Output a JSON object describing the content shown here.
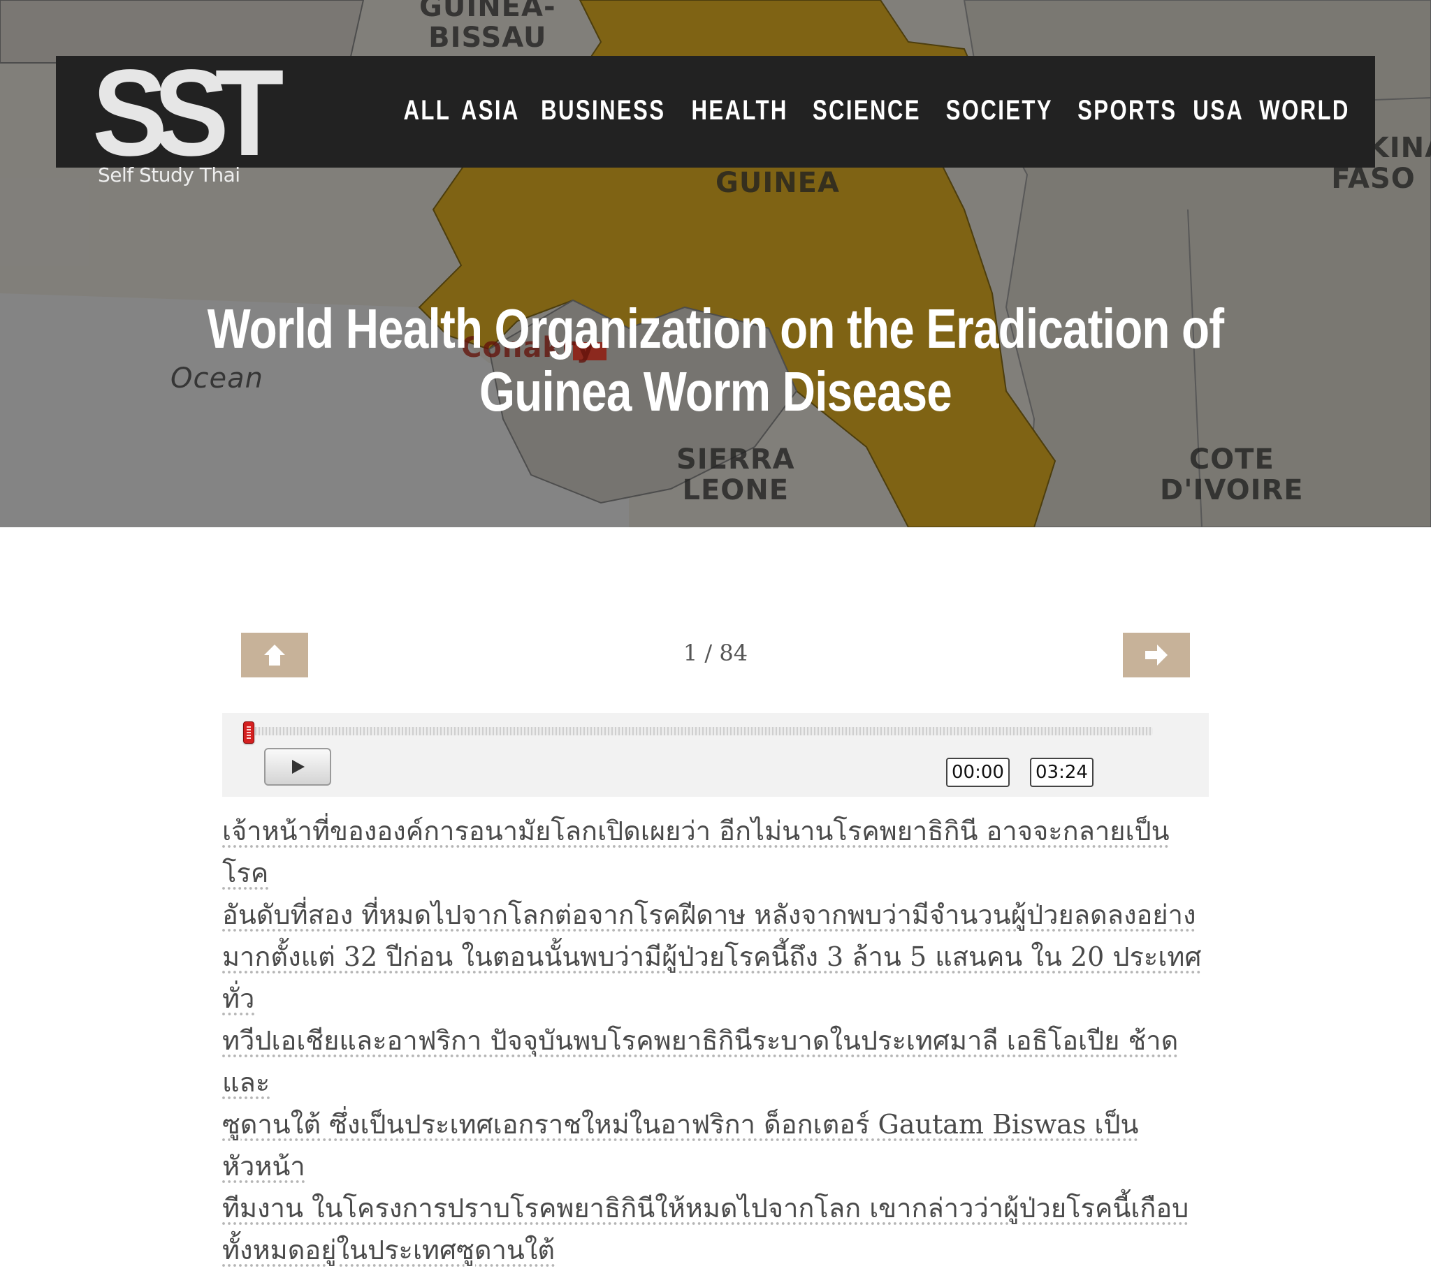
{
  "site": {
    "logo_text": "SST",
    "logo_subtitle": "Self Study Thai"
  },
  "nav": {
    "items": [
      "ALL",
      "ASIA",
      "BUSINESS",
      "HEALTH",
      "SCIENCE",
      "SOCIETY",
      "SPORTS",
      "USA",
      "WORLD"
    ]
  },
  "hero": {
    "map_labels": {
      "guinea_bissau": "GUINEA-\nBISSAU",
      "guinea": "GUINEA",
      "burkina_faso": "BURKINA\nFASO",
      "ocean": "Ocean",
      "conakry": "Conakry",
      "sierra_leone": "SIERRA\nLEONE",
      "cote_divoire": "COTE\nD'IVOIRE"
    },
    "colors": {
      "map_yellow": "#b08a1c",
      "map_land": "#a9a6a0"
    }
  },
  "article": {
    "title": "World Health Organization on the Eradication of Guinea Worm Disease"
  },
  "lesson": {
    "counter": "1 / 84",
    "up_icon": "arrow-up-icon",
    "next_icon": "arrow-right-icon",
    "accent": "#c7b299"
  },
  "audio": {
    "current_time": "00:00",
    "duration": "03:24",
    "progress": 0
  },
  "text": {
    "lines": [
      "เจ้าหน้าที่ขององค์การอนามัยโลกเปิดเผยว่า อีกไม่นานโรคพยาธิกินี อาจจะกลายเป็นโรค",
      "อันดับที่สอง ที่หมดไปจากโลกต่อจากโรคฝีดาษ หลังจากพบว่ามีจำนวนผู้ป่วยลดลงอย่าง",
      "มากตั้งแต่ 32 ปีก่อน ในตอนนั้นพบว่ามีผู้ป่วยโรคนี้ถึง 3 ล้าน 5 แสนคน ใน 20 ประเทศทั่ว",
      "ทวีปเอเชียและอาฟริกา ปัจจุบันพบโรคพยาธิกินีระบาดในประเทศมาลี เอธิโอเปีย ช้าดและ",
      "ซูดานใต้ ซึ่งเป็นประเทศเอกราชใหม่ในอาฟริกา ด็อกเตอร์ Gautam Biswas เป็นหัวหน้า",
      "ทีมงาน ในโครงการปราบโรคพยาธิกินีให้หมดไปจากโลก เขากล่าวว่าผู้ป่วยโรคนี้เกือบ",
      "ทั้งหมดอยู่ในประเทศซูดานใต้"
    ]
  }
}
